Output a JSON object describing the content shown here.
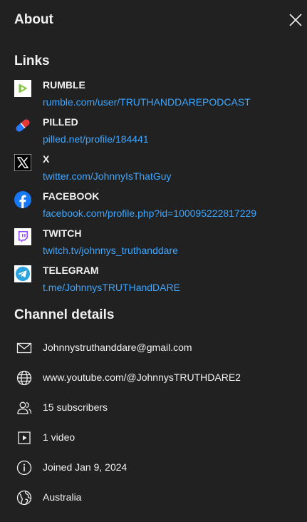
{
  "header": {
    "title": "About",
    "close_icon": "close-icon"
  },
  "links": {
    "title": "Links",
    "items": [
      {
        "name": "RUMBLE",
        "url": "rumble.com/user/TRUTHANDDAREPODCAST",
        "icon": "rumble-icon",
        "color": "#85c742"
      },
      {
        "name": "PILLED",
        "url": "pilled.net/profile/184441",
        "icon": "pilled-icon",
        "color": "#e53935"
      },
      {
        "name": "X",
        "url": "twitter.com/JohnnyIsThatGuy",
        "icon": "x-icon",
        "color": "#000000"
      },
      {
        "name": "FACEBOOK",
        "url": "facebook.com/profile.php?id=100095222817229",
        "icon": "facebook-icon",
        "color": "#1877f2"
      },
      {
        "name": "TWITCH",
        "url": "twitch.tv/johnnys_truthanddare",
        "icon": "twitch-icon",
        "color": "#9146ff"
      },
      {
        "name": "TELEGRAM",
        "url": "t.me/JohnnysTRUTHandDARE",
        "icon": "telegram-icon",
        "color": "#2aa3df"
      }
    ]
  },
  "details": {
    "title": "Channel details",
    "items": [
      {
        "text": "Johnnystruthanddare@gmail.com",
        "icon": "mail-icon"
      },
      {
        "text": "www.youtube.com/@JohnnysTRUTHDARE2",
        "icon": "globe-icon"
      },
      {
        "text": "15 subscribers",
        "icon": "subscribers-icon"
      },
      {
        "text": "1 video",
        "icon": "video-icon"
      },
      {
        "text": "Joined Jan 9, 2024",
        "icon": "info-icon"
      },
      {
        "text": "Australia",
        "icon": "earth-icon"
      }
    ]
  },
  "colors": {
    "background": "#212121",
    "text": "#f1f1f1",
    "link": "#3ea6ff"
  }
}
